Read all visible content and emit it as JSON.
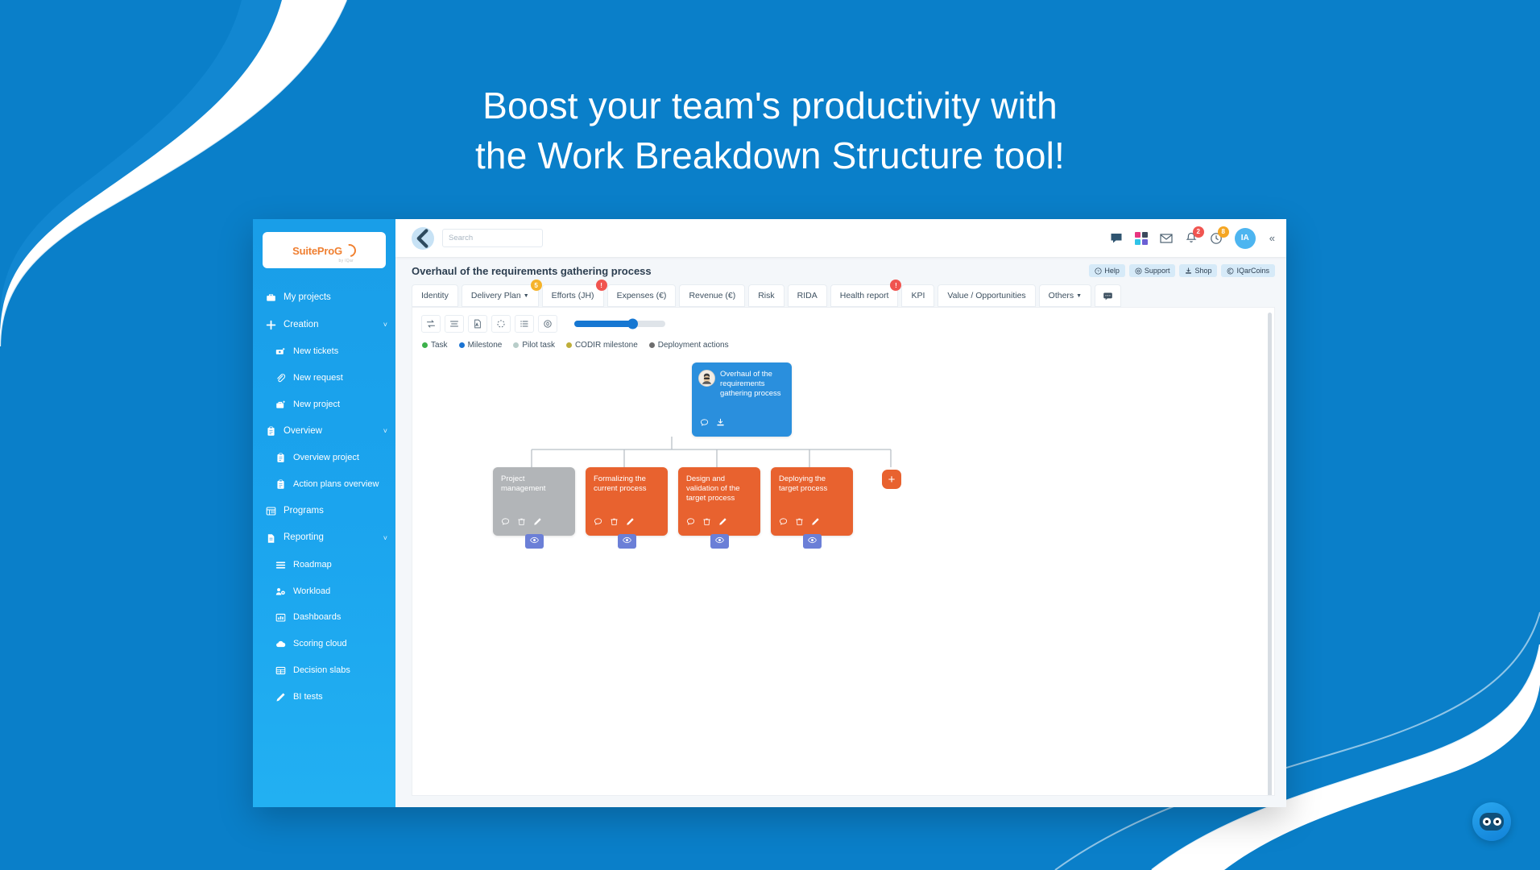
{
  "hero": {
    "line1": "Boost your team's productivity with",
    "line2": "the Work Breakdown Structure tool!"
  },
  "brand": {
    "logo_main": "SuitePro",
    "logo_mark": "G",
    "logo_sub": "by IQar"
  },
  "sidebar": {
    "items": [
      {
        "label": "My projects",
        "icon": "briefcase-icon",
        "level": "top",
        "chevron": ""
      },
      {
        "label": "Creation",
        "icon": "plus-icon",
        "level": "top",
        "chevron": "˅"
      },
      {
        "label": "New tickets",
        "icon": "ticket-plus-icon",
        "level": "sub",
        "chevron": ""
      },
      {
        "label": "New request",
        "icon": "paperclip-plus-icon",
        "level": "sub",
        "chevron": ""
      },
      {
        "label": "New project",
        "icon": "briefcase-plus-icon",
        "level": "sub",
        "chevron": ""
      },
      {
        "label": "Overview",
        "icon": "clipboard-icon",
        "level": "top",
        "chevron": "˅"
      },
      {
        "label": "Overview project",
        "icon": "clipboard-icon",
        "level": "sub",
        "chevron": ""
      },
      {
        "label": "Action plans overview",
        "icon": "clipboard-icon",
        "level": "sub",
        "chevron": ""
      },
      {
        "label": "Programs",
        "icon": "table-icon",
        "level": "top",
        "chevron": ""
      },
      {
        "label": "Reporting",
        "icon": "document-icon",
        "level": "top",
        "chevron": "˅"
      },
      {
        "label": "Roadmap",
        "icon": "list-icon",
        "level": "sub",
        "chevron": ""
      },
      {
        "label": "Workload",
        "icon": "users-gear-icon",
        "level": "sub",
        "chevron": ""
      },
      {
        "label": "Dashboards",
        "icon": "bar-chart-icon",
        "level": "sub",
        "chevron": ""
      },
      {
        "label": "Scoring cloud",
        "icon": "cloud-icon",
        "level": "sub",
        "chevron": ""
      },
      {
        "label": "Decision slabs",
        "icon": "grid-table-icon",
        "level": "sub",
        "chevron": ""
      },
      {
        "label": "BI tests",
        "icon": "pencil-icon",
        "level": "sub",
        "chevron": ""
      }
    ]
  },
  "topbar": {
    "back_label": "‹",
    "search_placeholder": "Search",
    "search_value": "",
    "icons": [
      {
        "name": "chat-icon",
        "badge": ""
      },
      {
        "name": "apps-grid-icon",
        "badge": ""
      },
      {
        "name": "mail-icon",
        "badge": ""
      },
      {
        "name": "bell-icon",
        "badge": "2",
        "badge_color": "red"
      },
      {
        "name": "timer-icon",
        "badge": "8",
        "badge_color": "amber"
      }
    ],
    "avatar_initials": "IA",
    "collapse_label": "«"
  },
  "page": {
    "title": "Overhaul of the requirements gathering process",
    "actions": [
      {
        "label": "Help",
        "icon": "question-circle-icon"
      },
      {
        "label": "Support",
        "icon": "lifebuoy-icon"
      },
      {
        "label": "Shop",
        "icon": "cart-icon"
      },
      {
        "label": "IQarCoins",
        "icon": "coin-icon"
      }
    ]
  },
  "tabs": [
    {
      "label": "Identity",
      "badge": "",
      "badge_color": "",
      "caret": false
    },
    {
      "label": "Delivery Plan",
      "badge": "5",
      "badge_color": "amber",
      "caret": true
    },
    {
      "label": "Efforts (JH)",
      "badge": "!",
      "badge_color": "red",
      "caret": false
    },
    {
      "label": "Expenses (€)",
      "badge": "",
      "badge_color": "",
      "caret": false
    },
    {
      "label": "Revenue (€)",
      "badge": "",
      "badge_color": "",
      "caret": false
    },
    {
      "label": "Risk",
      "badge": "",
      "badge_color": "",
      "caret": false
    },
    {
      "label": "RIDA",
      "badge": "",
      "badge_color": "",
      "caret": false
    },
    {
      "label": "Health report",
      "badge": "!",
      "badge_color": "red",
      "caret": false
    },
    {
      "label": "KPI",
      "badge": "",
      "badge_color": "",
      "caret": false
    },
    {
      "label": "Value / Opportunities",
      "badge": "",
      "badge_color": "",
      "caret": false
    },
    {
      "label": "Others",
      "badge": "",
      "badge_color": "",
      "caret": true
    }
  ],
  "tab_comment_icon": "comment-tab-icon",
  "toolbar": {
    "buttons": [
      {
        "name": "swap-orientation-icon"
      },
      {
        "name": "align-icon"
      },
      {
        "name": "export-pdf-icon"
      },
      {
        "name": "loading-circle-icon"
      },
      {
        "name": "list-detail-icon"
      },
      {
        "name": "zero-badge-icon"
      }
    ],
    "zoom_percent": 58
  },
  "legend": [
    {
      "label": "Task",
      "color": "#3db14b"
    },
    {
      "label": "Milestone",
      "color": "#1a73d2"
    },
    {
      "label": "Pilot task",
      "color": "#b8cdc9"
    },
    {
      "label": "CODIR milestone",
      "color": "#bfae3a"
    },
    {
      "label": "Deployment actions",
      "color": "#6e6e6e"
    }
  ],
  "wbs": {
    "root": {
      "title": "Overhaul of the requirements gathering process",
      "color": "#2a8fdd",
      "icons": [
        "comment-icon",
        "download-icon"
      ]
    },
    "children": [
      {
        "title": "Project management",
        "color": "#b2b5b8",
        "icons": [
          "comment-icon",
          "trash-icon",
          "pencil-icon"
        ],
        "eye": "eye-icon"
      },
      {
        "title": "Formalizing the current process",
        "color": "#e8622f",
        "icons": [
          "comment-icon",
          "trash-icon",
          "pencil-icon"
        ],
        "eye": "eye-icon"
      },
      {
        "title": "Design and validation of the target process",
        "color": "#e8622f",
        "icons": [
          "comment-icon",
          "trash-icon",
          "pencil-icon"
        ],
        "eye": "eye-icon"
      },
      {
        "title": "Deploying the target process",
        "color": "#e8622f",
        "icons": [
          "comment-icon",
          "trash-icon",
          "pencil-icon"
        ],
        "eye": "eye-icon"
      }
    ],
    "add_label": "+"
  },
  "chat_widget": {
    "name": "chatbot-avatar"
  }
}
